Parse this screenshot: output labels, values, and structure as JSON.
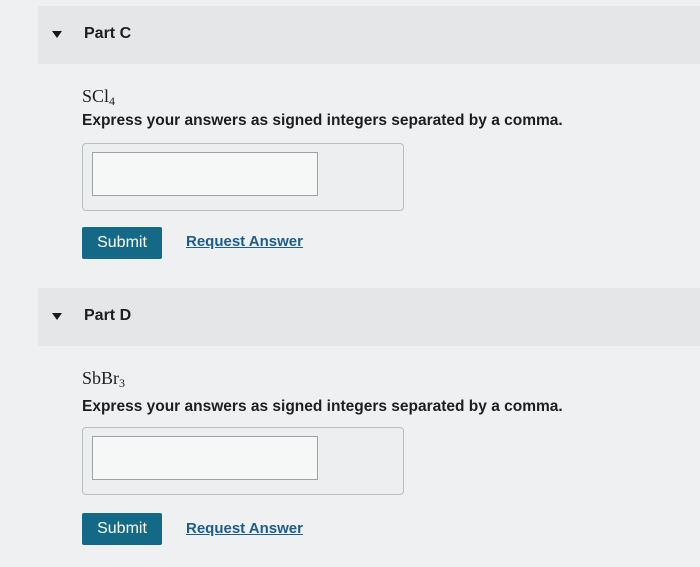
{
  "parts": [
    {
      "title": "Part C",
      "formula_base": "SCl",
      "formula_sub": "4",
      "instructions": "Express your answers as signed integers separated by a comma.",
      "answer_value": "",
      "submit_label": "Submit",
      "request_label": "Request Answer"
    },
    {
      "title": "Part D",
      "formula_base": "SbBr",
      "formula_sub": "3",
      "instructions": "Express your answers as signed integers separated by a comma.",
      "answer_value": "",
      "submit_label": "Submit",
      "request_label": "Request Answer"
    }
  ],
  "icons": {
    "collapse": "caret-down-icon"
  },
  "colors": {
    "submit_bg": "#146a86",
    "link": "#1b5d8c"
  }
}
